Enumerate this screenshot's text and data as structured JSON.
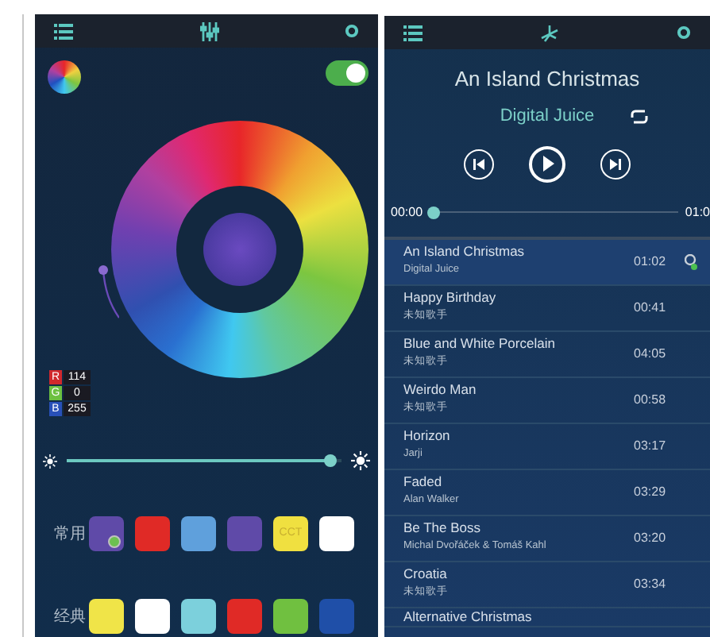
{
  "color_screen": {
    "power": {
      "on": true
    },
    "rgb": [
      {
        "label": "R",
        "value": "114",
        "color": "#d0282c"
      },
      {
        "label": "G",
        "value": "0",
        "color": "#6cc040"
      },
      {
        "label": "B",
        "value": "255",
        "color": "#2850b8"
      }
    ],
    "brightness": {
      "level": 0.96
    },
    "presets": [
      {
        "label": "常用",
        "swatches": [
          {
            "color": "#5f4aa8",
            "selected": true
          },
          {
            "color": "#e02a26",
            "selected": false
          },
          {
            "color": "#5fa0dc",
            "selected": false
          },
          {
            "color": "#5f4aa8",
            "selected": false
          },
          {
            "color": "#f0e040",
            "selected": false,
            "text": "CCT"
          },
          {
            "color": "#ffffff",
            "selected": false
          }
        ]
      },
      {
        "label": "经典",
        "swatches": [
          {
            "color": "#f0e448",
            "selected": false
          },
          {
            "color": "#ffffff",
            "selected": false
          },
          {
            "color": "#7cd0dc",
            "selected": false
          },
          {
            "color": "#e02a26",
            "selected": false
          },
          {
            "color": "#70c040",
            "selected": false
          },
          {
            "color": "#1f4fa8",
            "selected": false
          }
        ]
      }
    ]
  },
  "music_screen": {
    "title": "An Island Christmas",
    "artist": "Digital Juice",
    "elapsed": "00:00",
    "duration": "01:0",
    "progress": {
      "level": 0.02
    },
    "songs": [
      {
        "title": "An Island Christmas",
        "artist": "Digital Juice",
        "time": "01:02",
        "selected": true
      },
      {
        "title": "Happy Birthday",
        "artist": "未知歌手",
        "time": "00:41",
        "selected": false
      },
      {
        "title": "Blue and White Porcelain",
        "artist": "未知歌手",
        "time": "04:05",
        "selected": false
      },
      {
        "title": "Weirdo Man",
        "artist": "未知歌手",
        "time": "00:58",
        "selected": false
      },
      {
        "title": "Horizon",
        "artist": "Jarji",
        "time": "03:17",
        "selected": false
      },
      {
        "title": "Faded",
        "artist": "Alan Walker",
        "time": "03:29",
        "selected": false
      },
      {
        "title": "Be The Boss",
        "artist": "Michal Dvořáček & Tomáš Kahl",
        "time": "03:20",
        "selected": false
      },
      {
        "title": "Croatia",
        "artist": "未知歌手",
        "time": "03:34",
        "selected": false
      },
      {
        "title": "Alternative Christmas",
        "selected": false
      }
    ]
  }
}
